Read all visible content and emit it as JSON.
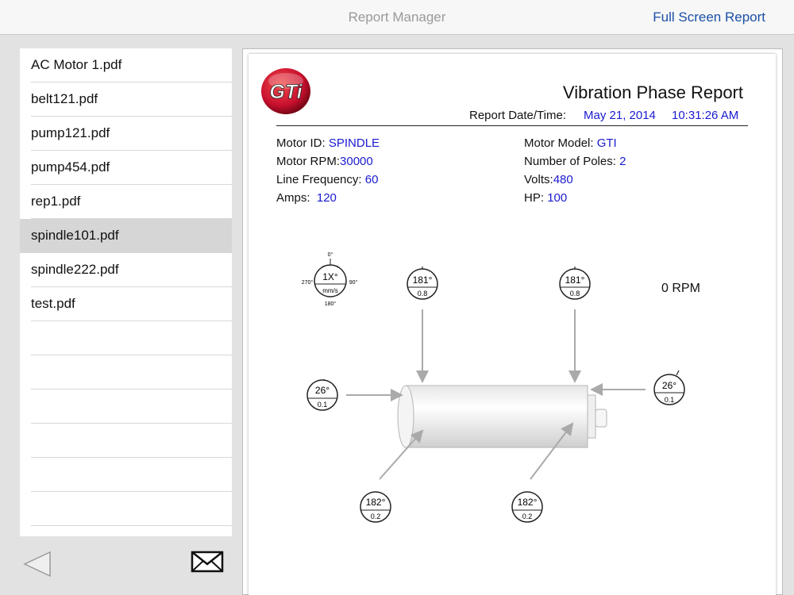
{
  "topbar": {
    "title": "Report Manager",
    "full_screen_label": "Full Screen Report"
  },
  "files": [
    "AC Motor 1.pdf",
    "belt121.pdf",
    "pump121.pdf",
    "pump454.pdf",
    "rep1.pdf",
    "spindle101.pdf",
    "spindle222.pdf",
    "test.pdf"
  ],
  "selected_file": "spindle101.pdf",
  "report": {
    "logo_text": "GTi",
    "title": "Vibration Phase Report",
    "date_label": "Report Date/Time:",
    "date": "May 21, 2014",
    "time": "10:31:26 AM",
    "motor_id_label": "Motor ID:",
    "motor_id": "SPINDLE",
    "motor_rpm_label": "Motor RPM:",
    "motor_rpm": "30000",
    "line_freq_label": "Line Frequency:",
    "line_freq": "60",
    "amps_label": "Amps:",
    "amps": "120",
    "motor_model_label": "Motor Model:",
    "motor_model": "GTI",
    "poles_label": "Number of Poles:",
    "poles": "2",
    "volts_label": "Volts:",
    "volts": "480",
    "hp_label": "HP:",
    "hp": "100",
    "rpm_readout": "0 RPM",
    "legend": {
      "top": "0°",
      "right": "90°",
      "bottom": "180°",
      "left": "270°",
      "center": "1X°",
      "unit": "mm/s"
    },
    "gauges": {
      "top_left": {
        "phase": "181°",
        "amp": "0.8"
      },
      "top_right": {
        "phase": "181°",
        "amp": "0.8"
      },
      "left": {
        "phase": "26°",
        "amp": "0.1"
      },
      "right": {
        "phase": "26°",
        "amp": "0.1"
      },
      "bottom_left": {
        "phase": "182°",
        "amp": "0.2"
      },
      "bottom_right": {
        "phase": "182°",
        "amp": "0.2"
      }
    }
  },
  "colors": {
    "link_blue": "#1a4fa6",
    "value_blue": "#1a1ad0",
    "logo_red": "#c8102e"
  },
  "icons": {
    "back": "triangle-left-icon",
    "mail": "envelope-icon"
  }
}
